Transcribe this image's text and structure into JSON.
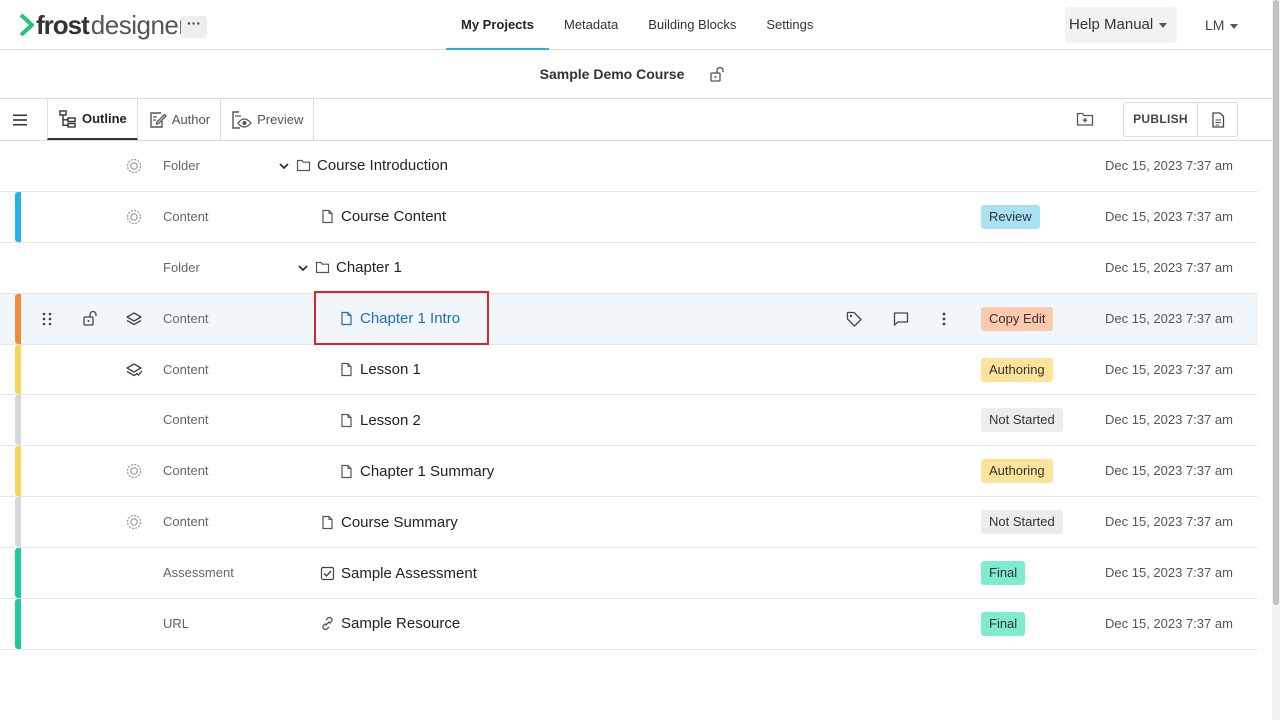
{
  "app": {
    "logo_main": "frost",
    "logo_sub": "designer",
    "more_label": "···",
    "colors": {
      "brand": "#22c37a",
      "accent": "#1fb5d6",
      "selected_link": "#1a6fb5",
      "highlight": "#d6262c"
    }
  },
  "topnav": {
    "tabs": [
      {
        "label": "My Projects",
        "active": true
      },
      {
        "label": "Metadata"
      },
      {
        "label": "Building Blocks"
      },
      {
        "label": "Settings"
      }
    ],
    "help_label": "Help Manual",
    "user_label": "LM"
  },
  "course": {
    "title": "Sample Demo Course"
  },
  "toolbar": {
    "views": [
      {
        "label": "Outline",
        "icon": "outline-icon",
        "active": true
      },
      {
        "label": "Author",
        "icon": "author-icon"
      },
      {
        "label": "Preview",
        "icon": "preview-icon"
      }
    ],
    "publish_label": "PUBLISH"
  },
  "rows": [
    {
      "type": "Folder",
      "title": "Course Introduction",
      "stripe": "",
      "state_icon": "gear",
      "expand": true,
      "item_icon": "folder",
      "status": "",
      "date": "Dec 15, 2023 7:37 am"
    },
    {
      "type": "Content",
      "title": "Course Content",
      "stripe": "#1fb5e6",
      "state_icon": "gear",
      "item_icon": "page",
      "status": "Review",
      "status_color": "#a9e1f2",
      "date": "Dec 15, 2023 7:37 am"
    },
    {
      "type": "Folder",
      "title": "Chapter 1",
      "stripe": "",
      "state_icon": "",
      "expand": true,
      "item_icon": "folder",
      "status": "",
      "date": "Dec 15, 2023 7:37 am"
    },
    {
      "type": "Content",
      "title": "Chapter 1 Intro",
      "stripe": "#f48a3e",
      "state_icon": "layers",
      "item_icon": "page",
      "status": "Copy Edit",
      "status_color": "#fcc9ac",
      "date": "Dec 15, 2023 7:37 am",
      "selected": true
    },
    {
      "type": "Content",
      "title": "Lesson 1",
      "stripe": "#f7d555",
      "state_icon": "layers-check",
      "item_icon": "page",
      "status": "Authoring",
      "status_color": "#fde29a",
      "date": "Dec 15, 2023 7:37 am"
    },
    {
      "type": "Content",
      "title": "Lesson 2",
      "stripe": "#d4d8db",
      "state_icon": "",
      "item_icon": "page",
      "status": "Not Started",
      "status_color": "#ececec",
      "date": "Dec 15, 2023 7:37 am"
    },
    {
      "type": "Content",
      "title": "Chapter 1 Summary",
      "stripe": "#f7d555",
      "state_icon": "gear",
      "item_icon": "page",
      "status": "Authoring",
      "status_color": "#fde29a",
      "date": "Dec 15, 2023 7:37 am"
    },
    {
      "type": "Content",
      "title": "Course Summary",
      "stripe": "#d4d8db",
      "state_icon": "gear",
      "item_icon": "page",
      "status": "Not Started",
      "status_color": "#ececec",
      "date": "Dec 15, 2023 7:37 am"
    },
    {
      "type": "Assessment",
      "title": "Sample Assessment",
      "stripe": "#1ec99a",
      "state_icon": "",
      "item_icon": "checkbox",
      "status": "Final",
      "status_color": "#7fecd0",
      "date": "Dec 15, 2023 7:37 am"
    },
    {
      "type": "URL",
      "title": "Sample Resource",
      "stripe": "#1ec99a",
      "state_icon": "",
      "item_icon": "link",
      "status": "Final",
      "status_color": "#7fecd0",
      "date": "Dec 15, 2023 7:37 am"
    }
  ]
}
